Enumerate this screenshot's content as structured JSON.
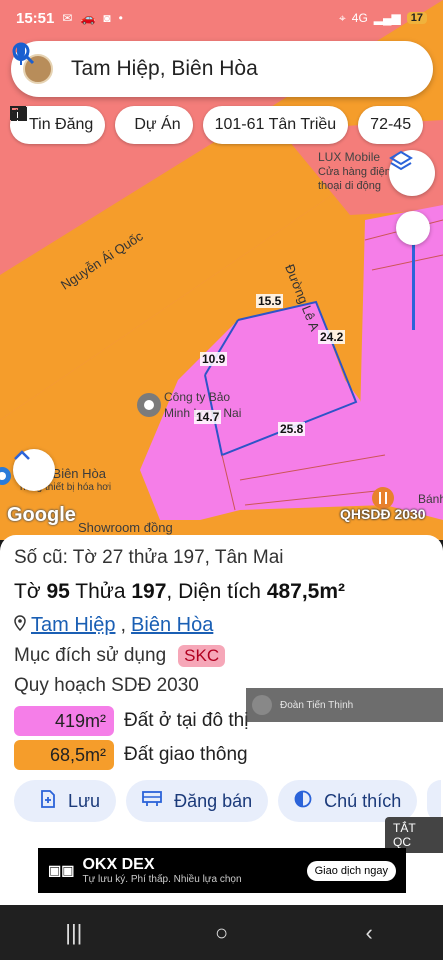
{
  "status_bar": {
    "time": "15:51",
    "network": "4G",
    "battery": "17"
  },
  "search": {
    "query": "Tam Hiệp, Biên Hòa"
  },
  "chips": [
    {
      "label": "Tin Đăng",
      "icon": "newspaper-icon"
    },
    {
      "label": "Dự Án",
      "icon": "building-icon"
    },
    {
      "label": "101-61 Tân Triều",
      "icon": ""
    },
    {
      "label": "72-45",
      "icon": ""
    }
  ],
  "map": {
    "street_labels": [
      "Nguyễn Ái Quốc",
      "Đường Lê A"
    ],
    "poi_labels": [
      "LUX Mobile",
      "Cửa hàng điện",
      "thoại di động",
      "Công ty Bảo",
      "Minh Long Nai",
      "rland Biên Hòa",
      "hàng thiết bị hóa hơi",
      "Showroom đồng",
      "Bánh c"
    ],
    "measurements": [
      "15.5",
      "24.2",
      "10.9",
      "14.7",
      "25.8"
    ],
    "google_logo": "Google",
    "overlay_label": "QHSDĐ 2030",
    "colors": {
      "residential": "#f57ee8",
      "transport": "#f59d2b",
      "land": "#f47d7a"
    }
  },
  "info": {
    "old_parcel": "Số cũ: Tờ 27 thửa 197, Tân Mai",
    "sheet_prefix": "Tờ",
    "sheet_number": "95",
    "parcel_prefix": "Thửa",
    "parcel_number": "197",
    "area_prefix": ", Diện tích",
    "area_value": "487,5m²",
    "ward": "Tam Hiệp",
    "city": "Biên Hòa",
    "purpose_label": "Mục đích sử dụng",
    "purpose_code": "SKC",
    "plan_label": "Quy hoạch SDĐ 2030",
    "areas": [
      {
        "value": "419m²",
        "label": "Đất ở tại đô thị",
        "color": "#f57ee8"
      },
      {
        "value": "68,5m²",
        "label": "Đất giao thông",
        "color": "#f59d2b"
      }
    ]
  },
  "watermark": {
    "text": "Đoàn Tiến Thịnh"
  },
  "actions": [
    {
      "label": "Lưu",
      "icon": "plus-doc-icon"
    },
    {
      "label": "Đăng bán",
      "icon": "billboard-icon"
    },
    {
      "label": "Chú thích",
      "icon": "contrast-icon"
    }
  ],
  "ad_close": "TẮT QC",
  "ad": {
    "brand": "OKX DEX",
    "sub": "Tự lưu ký. Phí thấp. Nhiều lựa chọn",
    "cta": "Giao dịch ngay"
  }
}
